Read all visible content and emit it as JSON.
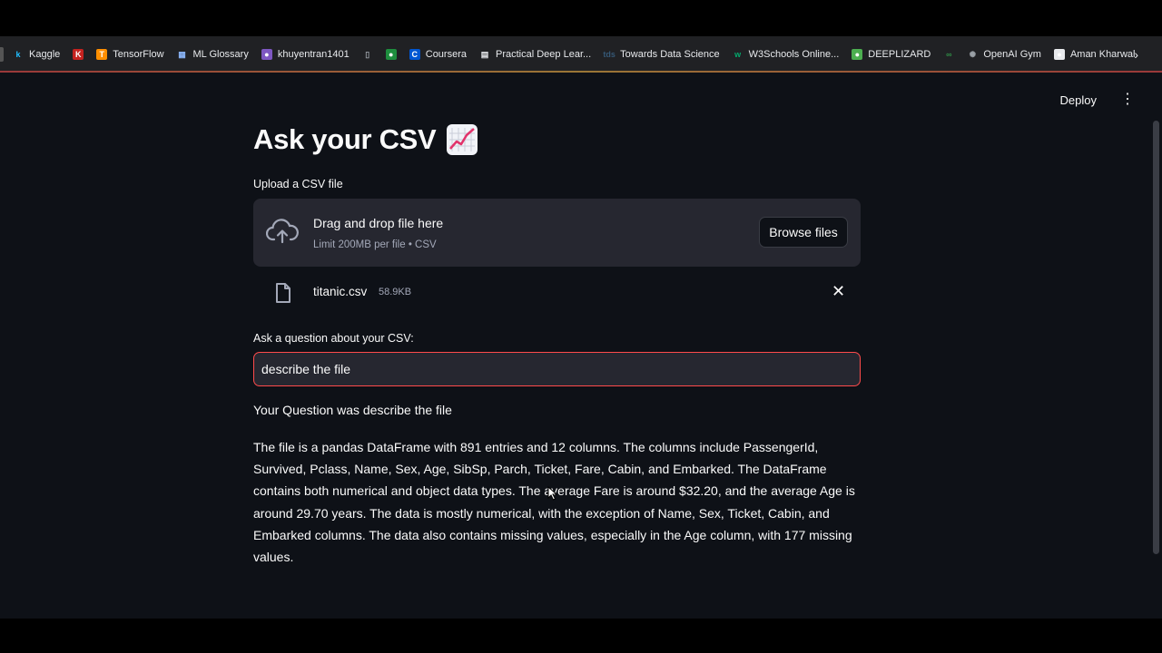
{
  "bookmarks": [
    {
      "label": "Kaggle",
      "icon": "kaggle-icon",
      "color": "#20beff",
      "glyph": "k"
    },
    {
      "label": "",
      "icon": "k-icon",
      "color": "#c5221f",
      "glyph": "K"
    },
    {
      "label": "TensorFlow",
      "icon": "tensorflow-icon",
      "color": "#ff8f00",
      "glyph": "T"
    },
    {
      "label": "ML Glossary",
      "icon": "glossary-icon",
      "color": "#8ab4f8",
      "glyph": "▦"
    },
    {
      "label": "khuyentran1401",
      "icon": "github-avatar-icon",
      "color": "#7e57c2",
      "glyph": "●"
    },
    {
      "label": "",
      "icon": "page-icon",
      "color": "#9aa0a6",
      "glyph": "▯"
    },
    {
      "label": "",
      "icon": "leaf-icon",
      "color": "#1e8e3e",
      "glyph": "●"
    },
    {
      "label": "Coursera",
      "icon": "coursera-icon",
      "color": "#0056d2",
      "glyph": "C"
    },
    {
      "label": "Practical Deep Lear...",
      "icon": "fastai-icon",
      "color": "#e8eaed",
      "glyph": "▤"
    },
    {
      "label": "Towards Data Science",
      "icon": "tds-icon",
      "color": "#355876",
      "glyph": "tds"
    },
    {
      "label": "W3Schools Online...",
      "icon": "w3schools-icon",
      "color": "#04aa6d",
      "glyph": "w"
    },
    {
      "label": "DEEPLIZARD",
      "icon": "deeplizard-icon",
      "color": "#4caf50",
      "glyph": "●"
    },
    {
      "label": "",
      "icon": "geeksforgeeks-icon",
      "color": "#2f8d46",
      "glyph": "∞"
    },
    {
      "label": "OpenAI Gym",
      "icon": "openai-icon",
      "color": "#9aa0a6",
      "glyph": "✺"
    },
    {
      "label": "Aman Kharwal",
      "icon": "medium-icon",
      "color": "#e8eaed",
      "glyph": "●"
    }
  ],
  "header": {
    "deploy_label": "Deploy"
  },
  "main": {
    "title": "Ask your CSV",
    "upload_label": "Upload a CSV file",
    "dropzone_title": "Drag and drop file here",
    "dropzone_sub": "Limit 200MB per file • CSV",
    "browse_label": "Browse files",
    "file_name": "titanic.csv",
    "file_size": "58.9KB",
    "question_label": "Ask a question about your CSV:",
    "question_value": "describe the file",
    "question_echo": "Your Question was describe the file",
    "answer": "The file is a pandas DataFrame with 891 entries and 12 columns. The columns include PassengerId, Survived, Pclass, Name, Sex, Age, SibSp, Parch, Ticket, Fare, Cabin, and Embarked. The DataFrame contains both numerical and object data types. The average Fare is around $32.20, and the average Age is around 29.70 years. The data is mostly numerical, with the exception of Name, Sex, Ticket, Cabin, and Embarked columns. The data also contains missing values, especially in the Age column, with 177 missing values."
  },
  "colors": {
    "accent": "#ff4b4b",
    "background": "#0e1117",
    "widget": "#262730"
  }
}
